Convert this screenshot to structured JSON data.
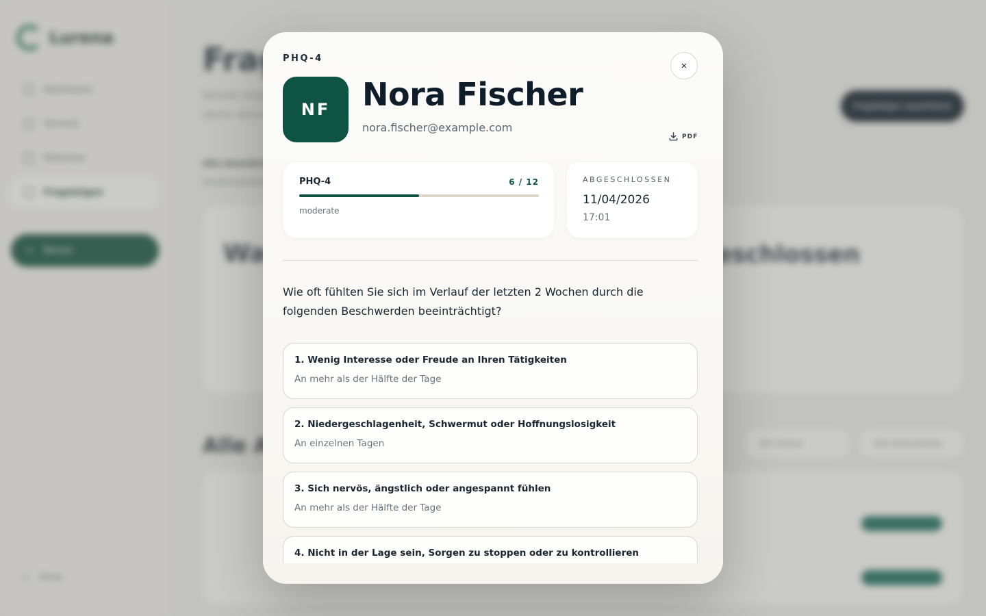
{
  "background": {
    "app_name": "Lurena",
    "nav": [
      "Dashboard",
      "Termine",
      "Patienten",
      "Fragebögen"
    ],
    "new_button": "Termin",
    "user": "Anna",
    "page_title": "Fragebögen",
    "page_subtitle": [
      "Behalte eingereichte Fragebögen",
      "deiner aktiven Patienten im Blick."
    ],
    "tab": "Alle demnächst",
    "export_button": "Fragebögen exportieren",
    "card_left_title": "Wartend",
    "card_right_title": "Abgeschlossen",
    "list_title": "Alle Abgaben",
    "filters": [
      "Alle Status",
      "Alle Instrumente"
    ]
  },
  "modal": {
    "kicker": "PHQ-4",
    "close_label": "×",
    "patient": {
      "initials": "NF",
      "name": "Nora Fischer",
      "email": "nora.fischer@example.com"
    },
    "pdf_label": "PDF",
    "score": {
      "label": "PHQ-4",
      "value": 6,
      "max": 12,
      "display": "6 / 12",
      "severity": "moderate"
    },
    "completed": {
      "label": "ABGESCHLOSSEN",
      "date": "11/04/2026",
      "time": "17:01"
    },
    "question": "Wie oft fühlten Sie sich im Verlauf der letzten 2 Wochen durch die folgenden Beschwerden beeinträchtigt?",
    "answers": [
      {
        "title": "1. Wenig Interesse oder Freude an Ihren Tätigkeiten",
        "value": "An mehr als der Hälfte der Tage"
      },
      {
        "title": "2. Niedergeschlagenheit, Schwermut oder Hoffnungslosigkeit",
        "value": "An einzelnen Tagen"
      },
      {
        "title": "3. Sich nervös, ängstlich oder angespannt fühlen",
        "value": "An mehr als der Hälfte der Tage"
      },
      {
        "title": "4. Nicht in der Lage sein, Sorgen zu stoppen oder zu kontrollieren",
        "value": ""
      }
    ]
  },
  "colors": {
    "brand_green": "#0f5342",
    "navy": "#111d29",
    "progress_track": "#ded4c7"
  }
}
